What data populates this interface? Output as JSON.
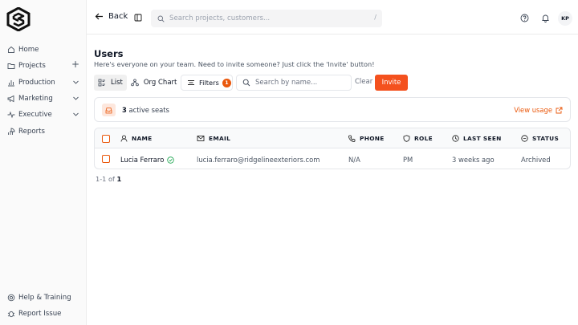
{
  "sidebar": {
    "items": [
      {
        "label": "Home",
        "icon": "home-icon"
      },
      {
        "label": "Projects",
        "icon": "folder-icon",
        "trail": "+"
      },
      {
        "label": "Production",
        "icon": "chart-icon",
        "trail": "⌄"
      },
      {
        "label": "Marketing",
        "icon": "megaphone-icon",
        "trail": "⌄"
      },
      {
        "label": "Executive",
        "icon": "activity-icon",
        "trail": "⌄"
      },
      {
        "label": "Reports",
        "icon": "report-icon"
      }
    ],
    "bottom": [
      {
        "label": "Help & Training",
        "icon": "help-icon"
      },
      {
        "label": "Report Issue",
        "icon": "bug-icon"
      }
    ]
  },
  "topbar": {
    "back_label": "Back",
    "search_placeholder": "Search projects, customers...",
    "search_shortcut": "/",
    "avatar_initials": "KP"
  },
  "page": {
    "title": "Users",
    "subtitle": "Here's everyone on your team. Need to invite someone? Just click the 'Invite' button!"
  },
  "toolbar": {
    "tab_list": "List",
    "tab_org": "Org Chart",
    "filters_label": "Filters",
    "filters_count": "1",
    "search_placeholder": "Search by name...",
    "clear_label": "Clear",
    "invite_label": "Invite"
  },
  "seats": {
    "count": "3",
    "label": "active seats",
    "link": "View usage"
  },
  "table": {
    "columns": {
      "name": "NAME",
      "email": "EMAIL",
      "phone": "PHONE",
      "role": "ROLE",
      "last_seen": "LAST SEEN",
      "status": "STATUS"
    },
    "rows": [
      {
        "name": "Lucia Ferraro",
        "email": "lucia.ferraro@ridgelineexteriors.com",
        "phone": "N/A",
        "role": "PM",
        "last_seen": "3 weeks ago",
        "status": "Archived"
      }
    ]
  },
  "pagination": {
    "range": "1-1",
    "of": "of",
    "total": "1"
  },
  "colors": {
    "accent": "#f4511e",
    "accent_text": "#ea580c"
  }
}
